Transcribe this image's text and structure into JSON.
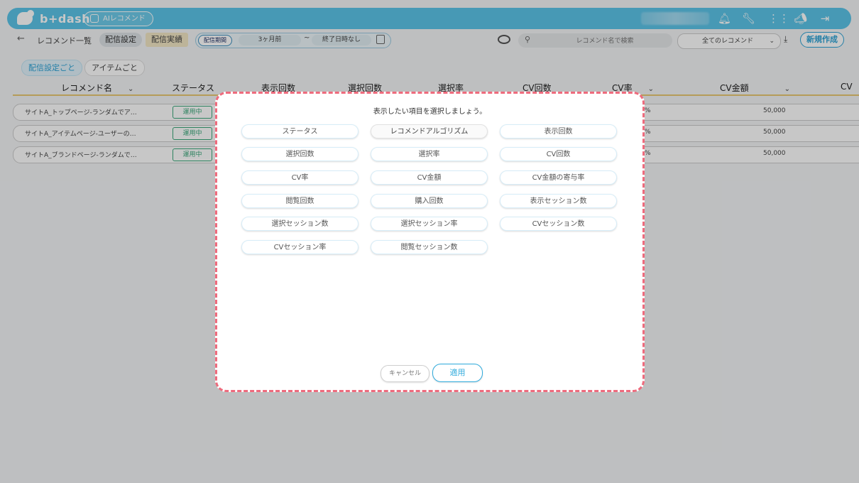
{
  "app": {
    "logo_text": "b+dash",
    "ai_badge": "AIレコメンド"
  },
  "toolbar_icons": [
    "bell-icon",
    "wrench-icon",
    "grid-icon",
    "megaphone-icon",
    "logout-icon"
  ],
  "nav": {
    "back": "←",
    "title": "レコメンド一覧",
    "tab_settings": "配信設定",
    "tab_results": "配信実績",
    "period_label": "配信期間",
    "period_start": "3ヶ月前",
    "period_sep": "~",
    "period_end": "終了日時なし",
    "search_placeholder": "レコメンド名で検索",
    "filter_value": "全てのレコメンド",
    "new_button": "新規作成"
  },
  "sub_tabs": {
    "by_setting": "配信設定ごと",
    "by_item": "アイテムごと"
  },
  "table": {
    "columns": [
      "レコメンド名",
      "ステータス",
      "表示回数",
      "選択回数",
      "選択率",
      "CV回数",
      "CV率",
      "CV金額",
      "CV"
    ],
    "rows": [
      {
        "name": "サイトA_トップページ-ランダムでア…",
        "status": "運用中",
        "pct": "%",
        "amount": "50,000"
      },
      {
        "name": "サイトA_アイテムページ-ユーザーの…",
        "status": "運用中",
        "pct": "%",
        "amount": "50,000"
      },
      {
        "name": "サイトA_ブランドページ-ランダムで…",
        "status": "運用中",
        "pct": "%",
        "amount": "50,000"
      }
    ]
  },
  "modal": {
    "title": "表示したい項目を選択しましょう。",
    "options": [
      "ステータス",
      "レコメンドアルゴリズム",
      "表示回数",
      "選択回数",
      "選択率",
      "CV回数",
      "CV率",
      "CV金額",
      "CV金額の寄与率",
      "閲覧回数",
      "購入回数",
      "表示セッション数",
      "選択セッション数",
      "選択セッション率",
      "CVセッション数",
      "CVセッション率",
      "閲覧セッション数"
    ],
    "cancel": "キャンセル",
    "apply": "適用"
  },
  "colors": {
    "accent": "#5bc4e8",
    "modal_border": "#ee6b7d",
    "status": "#3aa77a",
    "header_line": "#e8c873"
  }
}
